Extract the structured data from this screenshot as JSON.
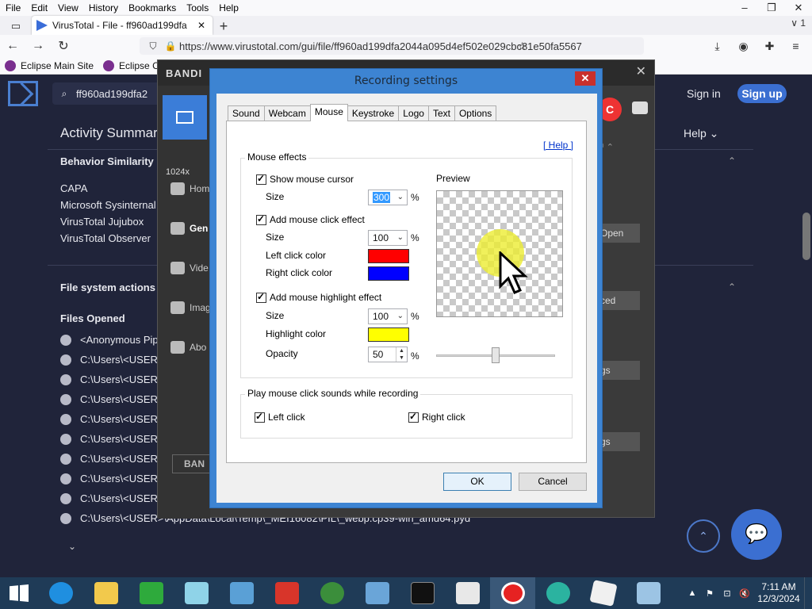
{
  "browser": {
    "menu": [
      "File",
      "Edit",
      "View",
      "History",
      "Bookmarks",
      "Tools",
      "Help"
    ],
    "tab_title": "VirusTotal - File - ff960ad199dfa",
    "tab_overflow": "1",
    "url": "https://www.virustotal.com/gui/file/ff960ad199dfa2044a095d4ef502e029cbc81e50fa5567",
    "bookmarks": [
      "Eclipse Main Site",
      "Eclipse Co"
    ]
  },
  "vt": {
    "search_value": "ff960ad199dfa2",
    "sign_in": "Sign in",
    "sign_up": "Sign up",
    "activity_title": "Activity Summar",
    "help": "Help",
    "behavior_similarity": "Behavior Similarity",
    "sandboxes": [
      "CAPA",
      "Microsoft Sysinternal",
      "VirusTotal Jujubox",
      "VirusTotal Observer"
    ],
    "fs_actions": "File system actions",
    "files_opened": "Files Opened",
    "files": [
      "<Anonymous Pip",
      "C:\\Users\\<USER>",
      "C:\\Users\\<USER>",
      "C:\\Users\\<USER>",
      "C:\\Users\\<USER>",
      "C:\\Users\\<USER>",
      "C:\\Users\\<USER>",
      "C:\\Users\\<USER>",
      "C:\\Users\\<USER>",
      "C:\\Users\\<USER>\\AppData\\Local\\Temp\\_MEI16082\\PIL\\_webp.cp39-win_amd64.pyd"
    ]
  },
  "bandicam": {
    "logo": "BANDI",
    "resolution": "1024x",
    "nav": [
      "Hom",
      "Gen",
      "Vide",
      "Imag",
      "Abo"
    ],
    "footer": "BAN",
    "rec_label": "C",
    "side_buttons": [
      "Open",
      "ced",
      "gs",
      "gs"
    ]
  },
  "dialog": {
    "title": "Recording settings",
    "tabs": [
      "Sound",
      "Webcam",
      "Mouse",
      "Keystroke",
      "Logo",
      "Text",
      "Options"
    ],
    "active_tab": "Mouse",
    "help": "[ Help ]",
    "mouse_effects": "Mouse effects",
    "show_cursor": "Show mouse cursor",
    "size_label": "Size",
    "cursor_size": "300",
    "pct": "%",
    "add_click": "Add mouse click effect",
    "click_size": "100",
    "left_click_color_label": "Left click color",
    "left_click_color": "#ff0000",
    "right_click_color_label": "Right click color",
    "right_click_color": "#0000ff",
    "add_highlight": "Add mouse highlight effect",
    "highlight_size": "100",
    "highlight_color_label": "Highlight color",
    "highlight_color": "#ffff00",
    "opacity_label": "Opacity",
    "opacity": "50",
    "preview": "Preview",
    "sounds_group": "Play mouse click sounds while recording",
    "left_click": "Left click",
    "right_click": "Right click",
    "ok": "OK",
    "cancel": "Cancel"
  },
  "taskbar": {
    "time": "7:11 AM",
    "date": "12/3/2024",
    "apps": [
      "ie",
      "explorer",
      "store",
      "notepad",
      "photos",
      "box",
      "download",
      "control",
      "cmd",
      "news",
      "bandicam",
      "snake",
      "obs",
      "perf"
    ]
  }
}
